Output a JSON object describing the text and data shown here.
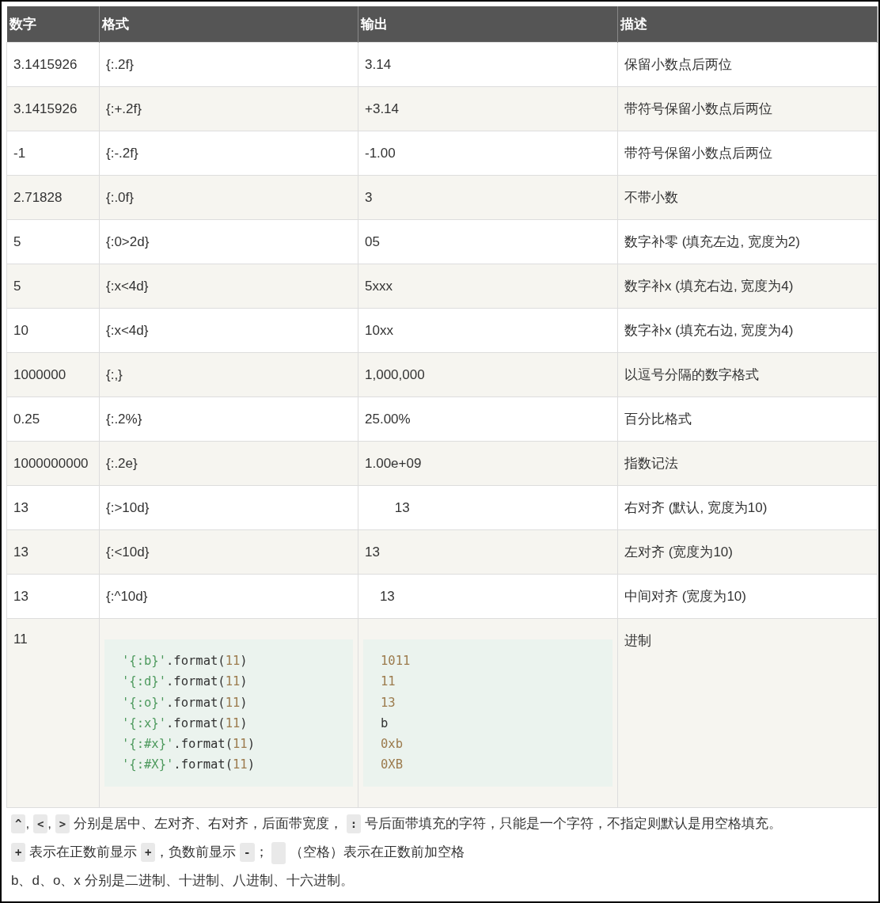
{
  "table": {
    "columns": [
      "数字",
      "格式",
      "输出",
      "描述"
    ],
    "rows": [
      {
        "kind": "text",
        "cells": [
          "3.1415926",
          "{:.2f}",
          "3.14",
          "保留小数点后两位"
        ]
      },
      {
        "kind": "text",
        "cells": [
          "3.1415926",
          "{:+.2f}",
          "+3.14",
          "带符号保留小数点后两位"
        ]
      },
      {
        "kind": "text",
        "cells": [
          "-1",
          "{:-.2f}",
          "-1.00",
          "带符号保留小数点后两位"
        ]
      },
      {
        "kind": "text",
        "cells": [
          "2.71828",
          "{:.0f}",
          "3",
          "不带小数"
        ]
      },
      {
        "kind": "text",
        "cells": [
          "5",
          "{:0>2d}",
          "05",
          "数字补零 (填充左边, 宽度为2)"
        ]
      },
      {
        "kind": "text",
        "cells": [
          "5",
          "{:x<4d}",
          "5xxx",
          "数字补x (填充右边, 宽度为4)"
        ]
      },
      {
        "kind": "text",
        "cells": [
          "10",
          "{:x<4d}",
          "10xx",
          "数字补x (填充右边, 宽度为4)"
        ]
      },
      {
        "kind": "text",
        "cells": [
          "1000000",
          "{:,}",
          "1,000,000",
          "以逗号分隔的数字格式"
        ]
      },
      {
        "kind": "text",
        "cells": [
          "0.25",
          "{:.2%}",
          "25.00%",
          "百分比格式"
        ]
      },
      {
        "kind": "text",
        "cells": [
          "1000000000",
          "{:.2e}",
          "1.00e+09",
          "指数记法"
        ]
      },
      {
        "kind": "text",
        "cells": [
          "13",
          "{:>10d}",
          "        13",
          "右对齐 (默认, 宽度为10)"
        ]
      },
      {
        "kind": "text",
        "cells": [
          "13",
          "{:<10d}",
          "13",
          "左对齐 (宽度为10)"
        ]
      },
      {
        "kind": "text",
        "cells": [
          "13",
          "{:^10d}",
          "    13",
          "中间对齐 (宽度为10)"
        ]
      },
      {
        "kind": "code",
        "number": "11",
        "description": "进制",
        "format_code": [
          [
            {
              "kind": "string",
              "text": "'{:b}'"
            },
            {
              "kind": "plain",
              "text": ".format("
            },
            {
              "kind": "number",
              "text": "11"
            },
            {
              "kind": "plain",
              "text": ")"
            }
          ],
          [
            {
              "kind": "string",
              "text": "'{:d}'"
            },
            {
              "kind": "plain",
              "text": ".format("
            },
            {
              "kind": "number",
              "text": "11"
            },
            {
              "kind": "plain",
              "text": ")"
            }
          ],
          [
            {
              "kind": "string",
              "text": "'{:o}'"
            },
            {
              "kind": "plain",
              "text": ".format("
            },
            {
              "kind": "number",
              "text": "11"
            },
            {
              "kind": "plain",
              "text": ")"
            }
          ],
          [
            {
              "kind": "string",
              "text": "'{:x}'"
            },
            {
              "kind": "plain",
              "text": ".format("
            },
            {
              "kind": "number",
              "text": "11"
            },
            {
              "kind": "plain",
              "text": ")"
            }
          ],
          [
            {
              "kind": "string",
              "text": "'{:#x}'"
            },
            {
              "kind": "plain",
              "text": ".format("
            },
            {
              "kind": "number",
              "text": "11"
            },
            {
              "kind": "plain",
              "text": ")"
            }
          ],
          [
            {
              "kind": "string",
              "text": "'{:#X}'"
            },
            {
              "kind": "plain",
              "text": ".format("
            },
            {
              "kind": "number",
              "text": "11"
            },
            {
              "kind": "plain",
              "text": ")"
            }
          ]
        ],
        "output_code": [
          [
            {
              "kind": "number",
              "text": "1011"
            }
          ],
          [
            {
              "kind": "number",
              "text": "11"
            }
          ],
          [
            {
              "kind": "number",
              "text": "13"
            }
          ],
          [
            {
              "kind": "plain",
              "text": "b"
            }
          ],
          [
            {
              "kind": "number",
              "text": "0xb"
            }
          ],
          [
            {
              "kind": "number",
              "text": "0XB"
            }
          ]
        ]
      }
    ]
  },
  "notes": [
    [
      {
        "kind": "code",
        "text": "^"
      },
      {
        "kind": "text",
        "text": ", "
      },
      {
        "kind": "code",
        "text": "<"
      },
      {
        "kind": "text",
        "text": ", "
      },
      {
        "kind": "code",
        "text": ">"
      },
      {
        "kind": "text",
        "text": " 分别是居中、左对齐、右对齐，后面带宽度， "
      },
      {
        "kind": "code",
        "text": ":"
      },
      {
        "kind": "text",
        "text": " 号后面带填充的字符，只能是一个字符，不指定则默认是用空格填充。"
      }
    ],
    [
      {
        "kind": "code",
        "text": "+"
      },
      {
        "kind": "text",
        "text": " 表示在正数前显示 "
      },
      {
        "kind": "code",
        "text": "+"
      },
      {
        "kind": "text",
        "text": "，负数前显示 "
      },
      {
        "kind": "code",
        "text": "-"
      },
      {
        "kind": "text",
        "text": "； "
      },
      {
        "kind": "blank"
      },
      {
        "kind": "text",
        "text": " （空格）表示在正数前加空格"
      }
    ],
    [
      {
        "kind": "text",
        "text": "b、d、o、x 分别是二进制、十进制、八进制、十六进制。"
      }
    ]
  ]
}
